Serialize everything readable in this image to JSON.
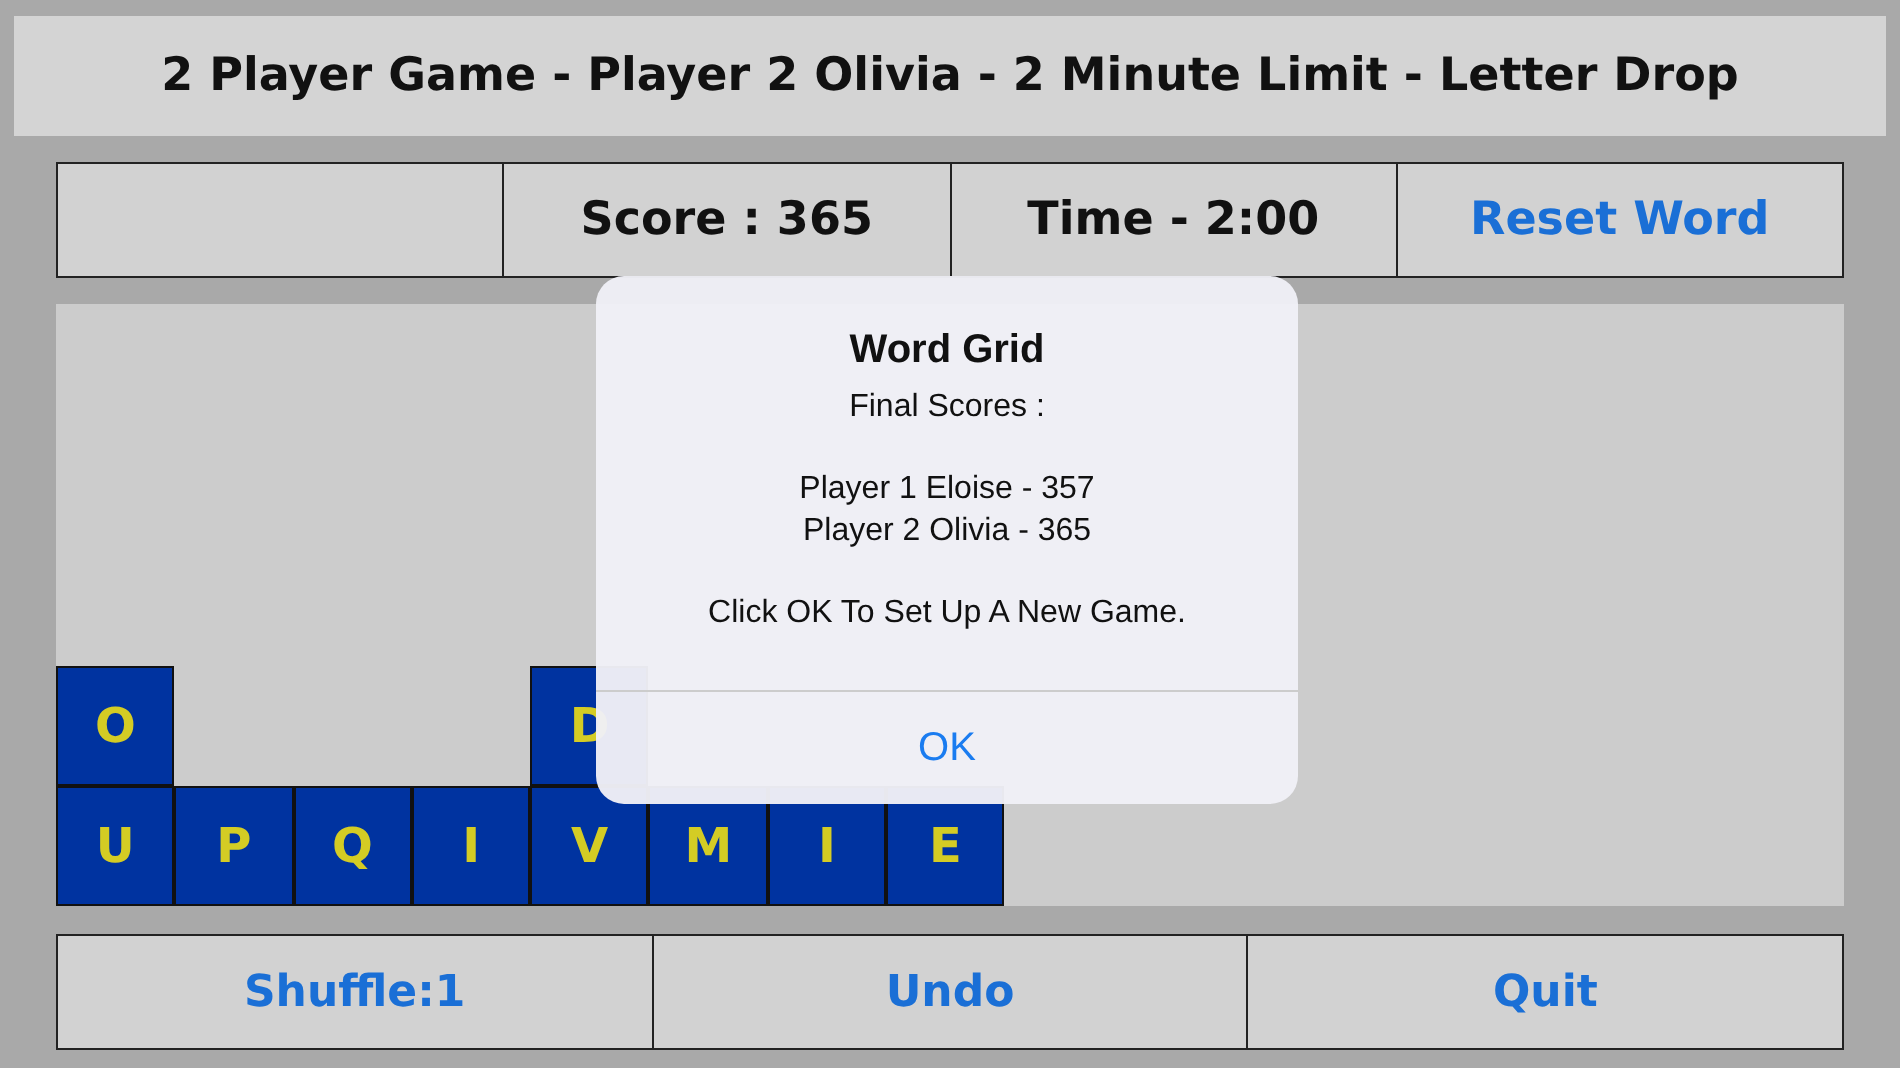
{
  "title": "2 Player Game - Player 2 Olivia - 2 Minute Limit - Letter Drop",
  "info": {
    "score": "Score : 365",
    "time": "Time - 2:00",
    "reset_button": "Reset Word"
  },
  "board": {
    "columns": [
      [
        "O",
        "U"
      ],
      [
        "P"
      ],
      [
        "Q"
      ],
      [
        "I"
      ],
      [
        "D",
        "V"
      ],
      [
        "M"
      ],
      [
        "I"
      ],
      [
        "E"
      ]
    ]
  },
  "buttons": [
    "Shuffle:1",
    "Undo",
    "Quit"
  ],
  "dialog": {
    "title": "Word Grid",
    "heading": "Final Scores :",
    "scores": [
      "Player 1 Eloise - 357",
      "Player 2 Olivia - 365"
    ],
    "prompt": "Click OK To Set Up A New Game.",
    "button": "OK"
  }
}
